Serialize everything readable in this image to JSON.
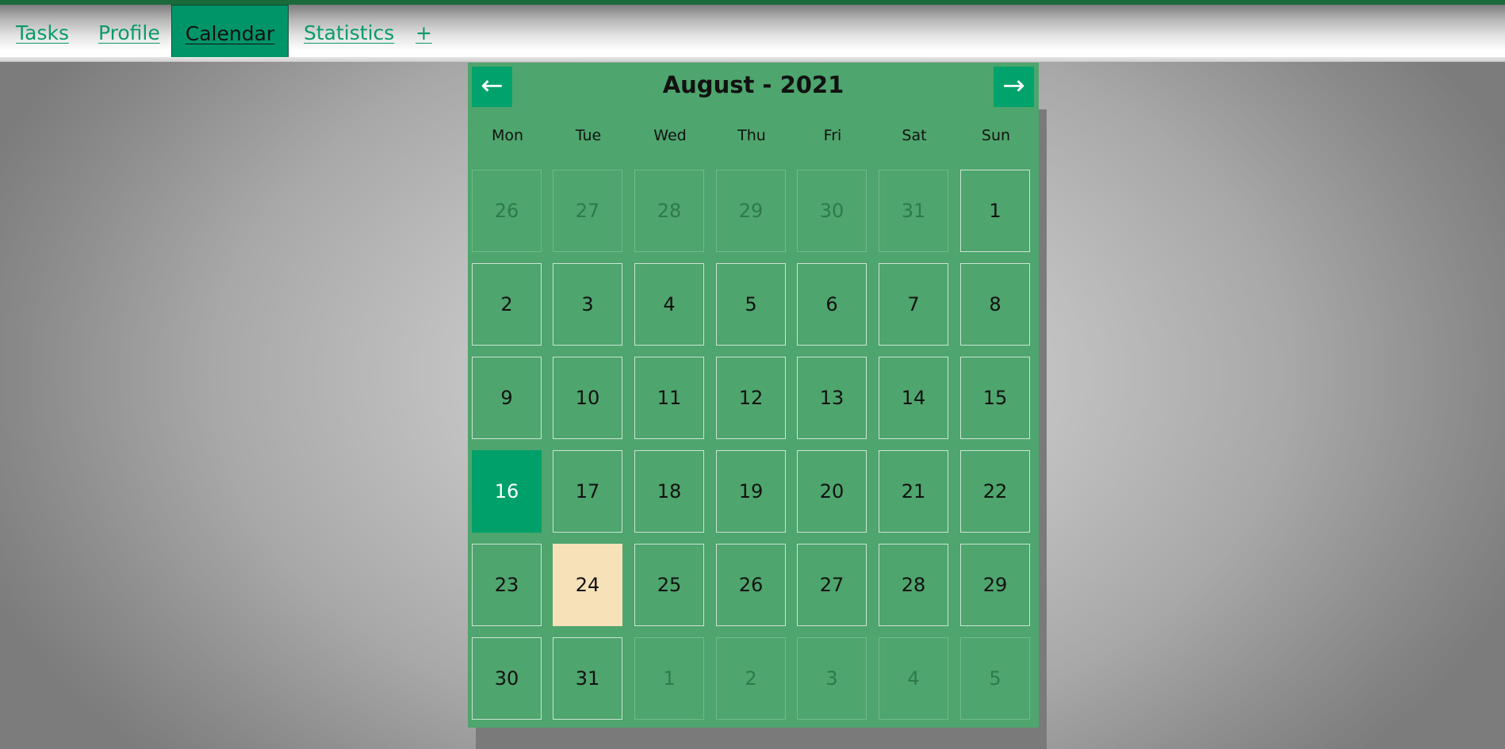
{
  "nav": {
    "items": [
      {
        "label": "Tasks",
        "active": false
      },
      {
        "label": "Profile",
        "active": false
      },
      {
        "label": "Calendar",
        "active": true
      },
      {
        "label": "Statistics",
        "active": false
      },
      {
        "label": "+",
        "active": false
      }
    ]
  },
  "calendar": {
    "title": "August - 2021",
    "prev_label": "←",
    "next_label": "→",
    "weekdays": [
      "Mon",
      "Tue",
      "Wed",
      "Thu",
      "Fri",
      "Sat",
      "Sun"
    ],
    "weeks": [
      [
        {
          "d": "26",
          "state": "dim"
        },
        {
          "d": "27",
          "state": "dim"
        },
        {
          "d": "28",
          "state": "dim"
        },
        {
          "d": "29",
          "state": "dim"
        },
        {
          "d": "30",
          "state": "dim"
        },
        {
          "d": "31",
          "state": "dim"
        },
        {
          "d": "1",
          "state": ""
        }
      ],
      [
        {
          "d": "2",
          "state": ""
        },
        {
          "d": "3",
          "state": ""
        },
        {
          "d": "4",
          "state": ""
        },
        {
          "d": "5",
          "state": ""
        },
        {
          "d": "6",
          "state": ""
        },
        {
          "d": "7",
          "state": ""
        },
        {
          "d": "8",
          "state": ""
        }
      ],
      [
        {
          "d": "9",
          "state": ""
        },
        {
          "d": "10",
          "state": ""
        },
        {
          "d": "11",
          "state": ""
        },
        {
          "d": "12",
          "state": ""
        },
        {
          "d": "13",
          "state": ""
        },
        {
          "d": "14",
          "state": ""
        },
        {
          "d": "15",
          "state": ""
        }
      ],
      [
        {
          "d": "16",
          "state": "selected"
        },
        {
          "d": "17",
          "state": ""
        },
        {
          "d": "18",
          "state": ""
        },
        {
          "d": "19",
          "state": ""
        },
        {
          "d": "20",
          "state": ""
        },
        {
          "d": "21",
          "state": ""
        },
        {
          "d": "22",
          "state": ""
        }
      ],
      [
        {
          "d": "23",
          "state": ""
        },
        {
          "d": "24",
          "state": "today"
        },
        {
          "d": "25",
          "state": ""
        },
        {
          "d": "26",
          "state": ""
        },
        {
          "d": "27",
          "state": ""
        },
        {
          "d": "28",
          "state": ""
        },
        {
          "d": "29",
          "state": ""
        }
      ],
      [
        {
          "d": "30",
          "state": ""
        },
        {
          "d": "31",
          "state": ""
        },
        {
          "d": "1",
          "state": "dim"
        },
        {
          "d": "2",
          "state": "dim"
        },
        {
          "d": "3",
          "state": "dim"
        },
        {
          "d": "4",
          "state": "dim"
        },
        {
          "d": "5",
          "state": "dim"
        }
      ]
    ]
  },
  "colors": {
    "accent": "#00a36b",
    "calendar_bg": "#4ea56d",
    "today_highlight": "#f6e1b8",
    "top_line": "#1b6a3b"
  }
}
